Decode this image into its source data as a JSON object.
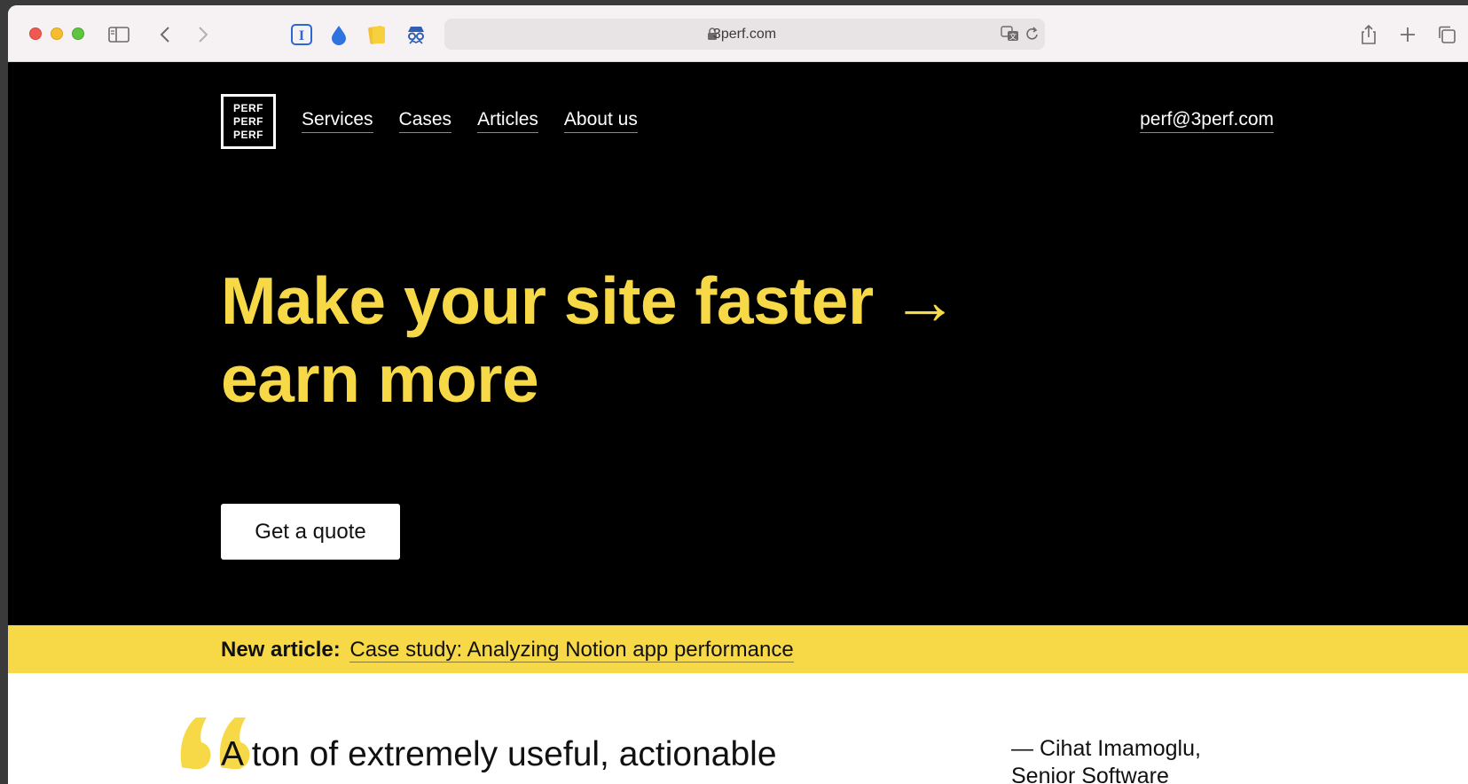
{
  "browser": {
    "address": "3perf.com",
    "icons": [
      "sidebar-icon",
      "back-icon",
      "forward-icon",
      "instapaper-icon",
      "raindrop-icon",
      "notes-icon",
      "spy-icon",
      "lock-icon",
      "translate-icon",
      "reload-icon",
      "share-icon",
      "new-tab-icon",
      "tabs-overview-icon"
    ]
  },
  "site": {
    "logo": [
      "PERF",
      "PERF",
      "PERF"
    ],
    "nav": [
      "Services",
      "Cases",
      "Articles",
      "About us"
    ],
    "email": "perf@3perf.com",
    "hero": {
      "line1": "Make your site faster →",
      "line2": "earn more"
    },
    "cta": "Get a quote",
    "banner": {
      "label": "New article:",
      "link": "Case study: Analyzing Notion app performance"
    },
    "quote": {
      "text": "A ton of extremely useful, actionable",
      "author_line1": "— Cihat Imamoglu,",
      "author_line2": "Senior Software"
    },
    "colors": {
      "accent": "#f7d948",
      "background": "#000000"
    }
  }
}
